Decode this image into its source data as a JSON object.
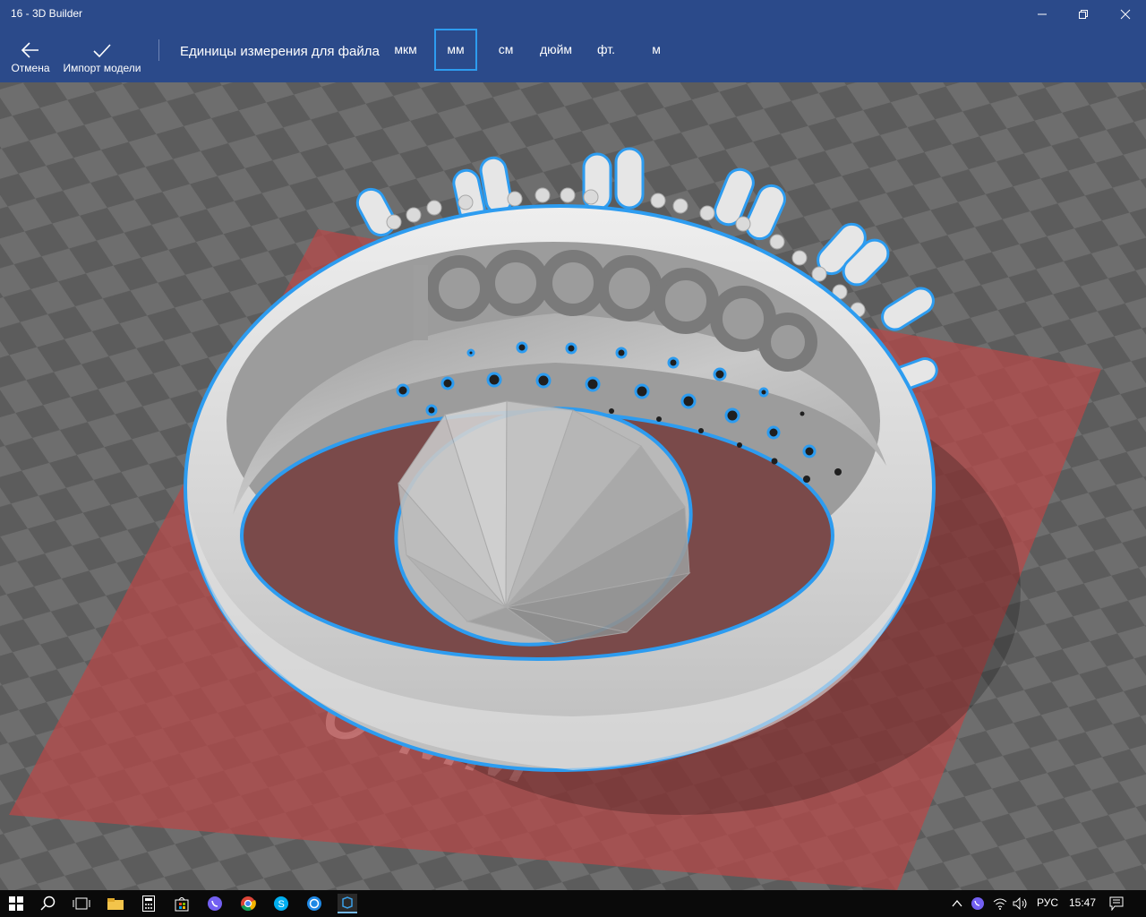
{
  "window": {
    "title": "16 - 3D Builder"
  },
  "toolbar": {
    "cancel_label": "Отмена",
    "import_label": "Импорт модели",
    "units_label": "Единицы измерения для файла",
    "units": [
      "мкм",
      "мм",
      "см",
      "дюйм",
      "фт.",
      "м"
    ],
    "selected_unit": "мм"
  },
  "viewport": {
    "plate_label": "0 мм"
  },
  "taskbar": {
    "language": "РУС",
    "time": "15:47"
  },
  "colors": {
    "accent": "#2b4a8a",
    "selection": "#2d9cf0",
    "plate": "#b84848",
    "model": "#d4d4d4"
  }
}
